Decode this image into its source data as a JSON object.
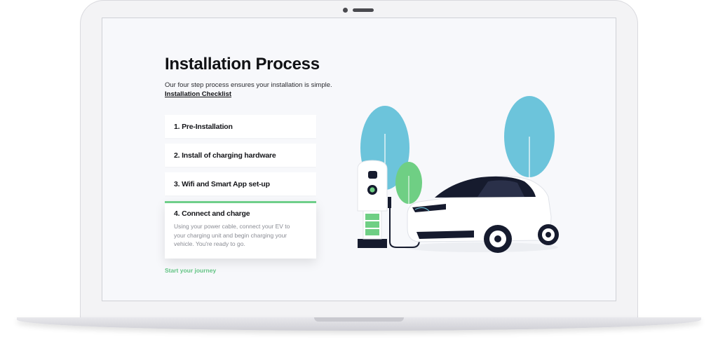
{
  "page": {
    "title": "Installation Process",
    "intro": "Our four step process ensures your installation is simple.",
    "checklist_link": "Installation Checklist",
    "cta_link": "Start your journey"
  },
  "steps": [
    {
      "label": "1. Pre-Installation"
    },
    {
      "label": "2. Install of charging hardware"
    },
    {
      "label": "3. Wifi and Smart App set-up"
    },
    {
      "label": "4. Connect and charge",
      "description": "Using your power cable, connect your EV to your charging unit and begin charging your vehicle. You're ready to go."
    }
  ],
  "colors": {
    "accent_green": "#6fcf8a",
    "link_green": "#63c484",
    "tree_blue": "#6cc4db",
    "tree_green": "#6fcf84",
    "car_dark": "#161b2e"
  },
  "icons": [
    "ev-charger-icon",
    "car-icon",
    "tree-icon"
  ]
}
